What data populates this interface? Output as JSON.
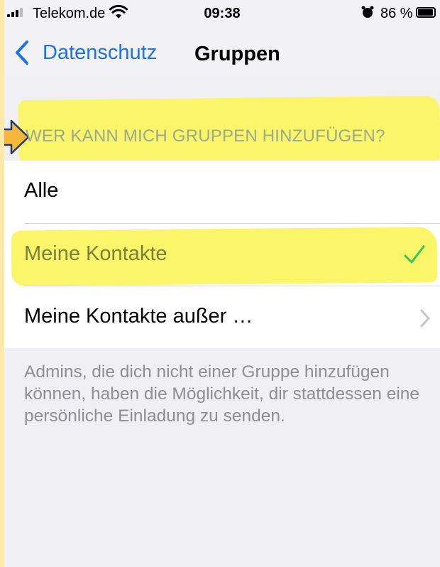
{
  "status_bar": {
    "carrier": "Telekom.de",
    "time": "09:38",
    "battery_percent": "86 %",
    "battery_level": 0.86,
    "icons": [
      "signal-icon",
      "wifi-icon",
      "alarm-icon",
      "battery-icon"
    ]
  },
  "nav": {
    "back_label": "Datenschutz",
    "title": "Gruppen"
  },
  "section": {
    "header": "WER KANN MICH GRUPPEN HINZUFÜGEN?",
    "options": [
      {
        "label": "Alle",
        "selected": false
      },
      {
        "label": "Meine Kontakte",
        "selected": true
      },
      {
        "label": "Meine Kontakte außer …",
        "selected": false,
        "disclosure": true
      }
    ],
    "footer": "Admins, die dich nicht einer Gruppe hinzufügen können, haben die Möglichkeit, dir stattdessen eine persönliche Einladung zu senden."
  },
  "colors": {
    "accent": "#1a73e8",
    "highlight": "#fbf56a",
    "checkmark": "#34c759",
    "background": "#efeff4",
    "border": "#fde9a8"
  }
}
